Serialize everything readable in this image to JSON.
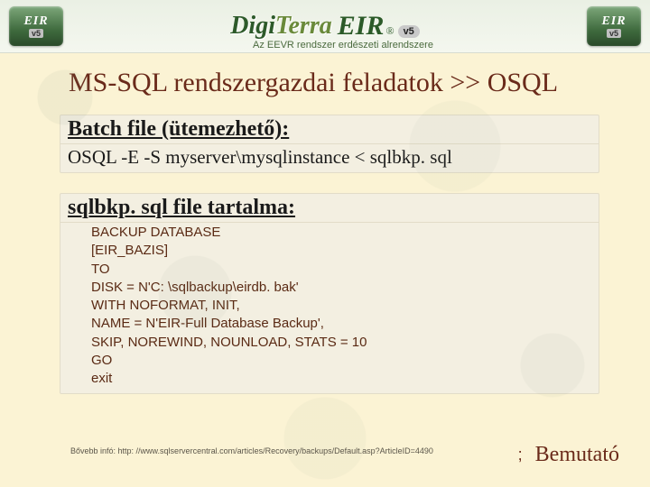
{
  "header": {
    "logo_small_line1": "EIR",
    "logo_small_line2": "v5",
    "center_word1": "Digi",
    "center_word2": "Terra",
    "badge_text": "EIR",
    "badge_reg": "®",
    "badge_ver": "v5",
    "subtag": "Az EEVR rendszer erdészeti alrendszere"
  },
  "title": "MS-SQL rendszergazdai feladatok >> OSQL",
  "box1": {
    "head": "Batch file (ütemezhető):",
    "line": "OSQL -E -S myserver\\mysqlinstance < sqlbkp. sql"
  },
  "box2": {
    "head": "sqlbkp. sql file tartalma:",
    "code": "BACKUP DATABASE\n[EIR_BAZIS]\nTO\nDISK = N'C: \\sqlbackup\\eirdb. bak'\nWITH NOFORMAT, INIT,\nNAME = N'EIR-Full Database Backup',\nSKIP, NOREWIND, NOUNLOAD, STATS = 10\nGO\nexit"
  },
  "footer_ref": "Bővebb infó: http: //www.sqlservercentral.com/articles/Recovery/backups/Default.asp?ArticleID=4490",
  "footer_right": "Bemutató",
  "footer_bullet": ";"
}
